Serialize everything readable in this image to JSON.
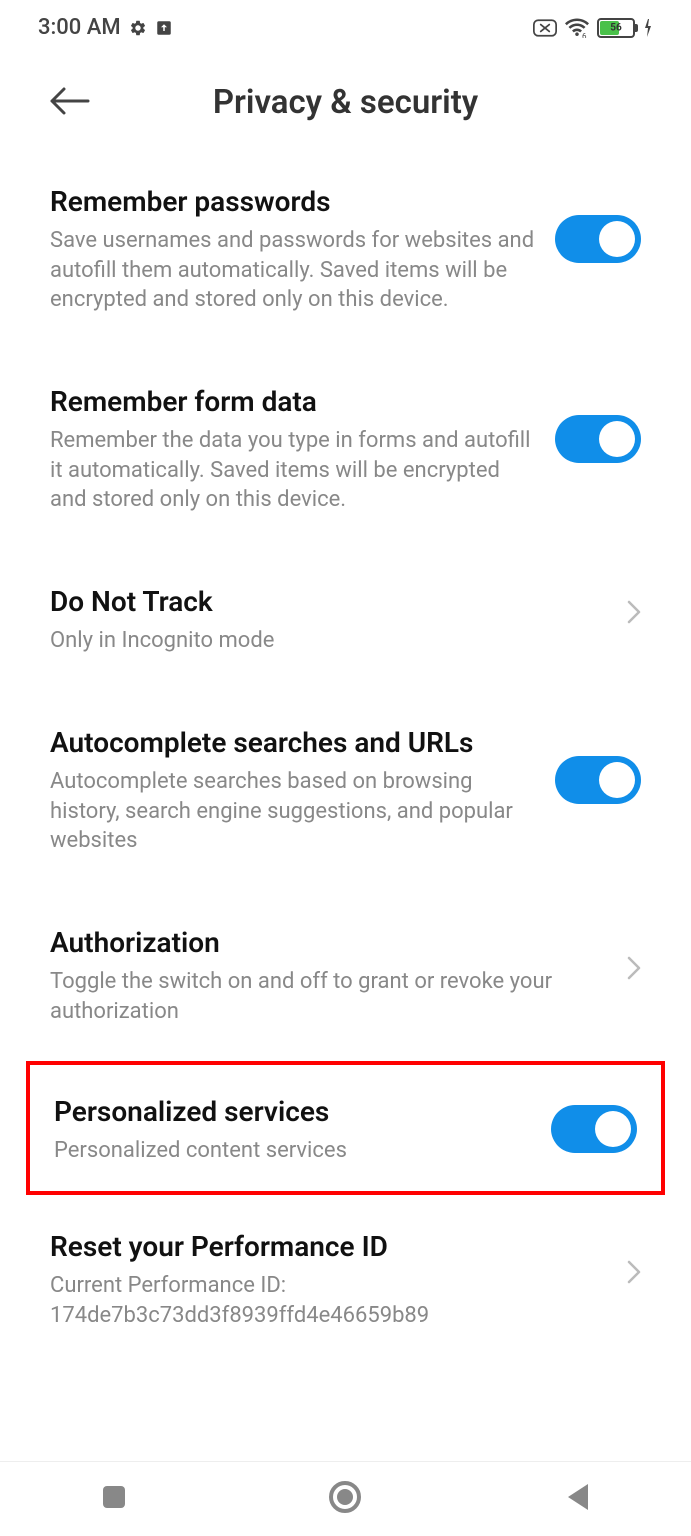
{
  "statusBar": {
    "time": "3:00 AM",
    "battery": "56"
  },
  "header": {
    "title": "Privacy & security"
  },
  "settings": {
    "rememberPasswords": {
      "title": "Remember passwords",
      "desc": "Save usernames and passwords for websites and autofill them automatically. Saved items will be encrypted and stored only on this device."
    },
    "rememberFormData": {
      "title": "Remember form data",
      "desc": "Remember the data you type in forms and autofill it automatically. Saved items will be encrypted and stored only on this device."
    },
    "doNotTrack": {
      "title": "Do Not Track",
      "desc": "Only in Incognito mode"
    },
    "autocomplete": {
      "title": "Autocomplete searches and URLs",
      "desc": "Autocomplete searches based on browsing history, search engine suggestions, and popular websites"
    },
    "authorization": {
      "title": "Authorization",
      "desc": "Toggle the switch on and off to grant or revoke your authorization"
    },
    "personalized": {
      "title": "Personalized services",
      "desc": "Personalized content services"
    },
    "resetId": {
      "title": "Reset your Performance ID",
      "desc": "Current Performance ID: 174de7b3c73dd3f8939ffd4e46659b89"
    }
  }
}
